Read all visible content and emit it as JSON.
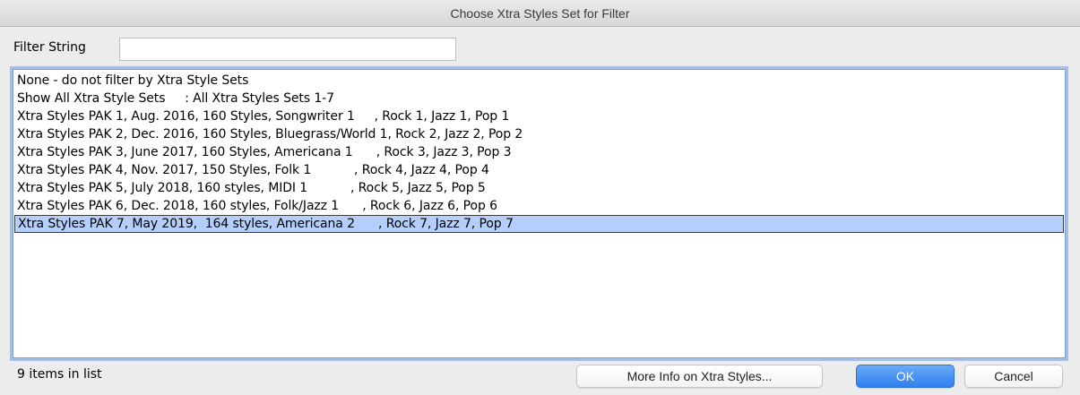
{
  "window": {
    "title": "Choose Xtra Styles Set for Filter"
  },
  "filter": {
    "label": "Filter String",
    "value": ""
  },
  "list": {
    "items": [
      "None - do not filter by Xtra Style Sets",
      "Show All Xtra Style Sets     : All Xtra Styles Sets 1-7",
      "Xtra Styles PAK 1, Aug. 2016, 160 Styles, Songwriter 1     , Rock 1, Jazz 1, Pop 1",
      "Xtra Styles PAK 2, Dec. 2016, 160 Styles, Bluegrass/World 1, Rock 2, Jazz 2, Pop 2",
      "Xtra Styles PAK 3, June 2017, 160 Styles, Americana 1      , Rock 3, Jazz 3, Pop 3",
      "Xtra Styles PAK 4, Nov. 2017, 150 Styles, Folk 1           , Rock 4, Jazz 4, Pop 4",
      "Xtra Styles PAK 5, July 2018, 160 styles, MIDI 1           , Rock 5, Jazz 5, Pop 5",
      "Xtra Styles PAK 6, Dec. 2018, 160 styles, Folk/Jazz 1      , Rock 6, Jazz 6, Pop 6",
      "Xtra Styles PAK 7, May 2019,  164 styles, Americana 2      , Rock 7, Jazz 7, Pop 7"
    ],
    "selected_index": 8
  },
  "footer": {
    "count_text": "9 items in list",
    "more_info_label": "More Info on Xtra Styles...",
    "ok_label": "OK",
    "cancel_label": "Cancel"
  }
}
